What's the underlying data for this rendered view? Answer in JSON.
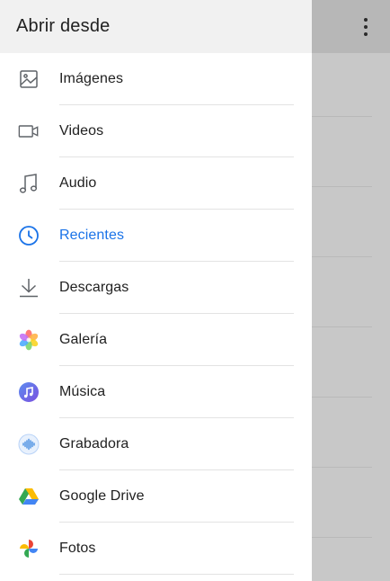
{
  "header": {
    "title": "Abrir desde"
  },
  "overflow_menu": {
    "icon": "more-vert-icon"
  },
  "items": [
    {
      "label": "Imágenes",
      "icon": "image-icon",
      "active": false
    },
    {
      "label": "Videos",
      "icon": "video-icon",
      "active": false
    },
    {
      "label": "Audio",
      "icon": "music-note-icon",
      "active": false
    },
    {
      "label": "Recientes",
      "icon": "clock-icon",
      "active": true
    },
    {
      "label": "Descargas",
      "icon": "download-icon",
      "active": false
    },
    {
      "label": "Galería",
      "icon": "gallery-flower-icon",
      "active": false
    },
    {
      "label": "Música",
      "icon": "music-app-icon",
      "active": false
    },
    {
      "label": "Grabadora",
      "icon": "voice-recorder-icon",
      "active": false
    },
    {
      "label": "Google Drive",
      "icon": "google-drive-icon",
      "active": false
    },
    {
      "label": "Fotos",
      "icon": "google-photos-icon",
      "active": false
    }
  ],
  "colors": {
    "accent": "#1a73e8",
    "text": "#212121",
    "scrim": "#c8c8c8"
  }
}
